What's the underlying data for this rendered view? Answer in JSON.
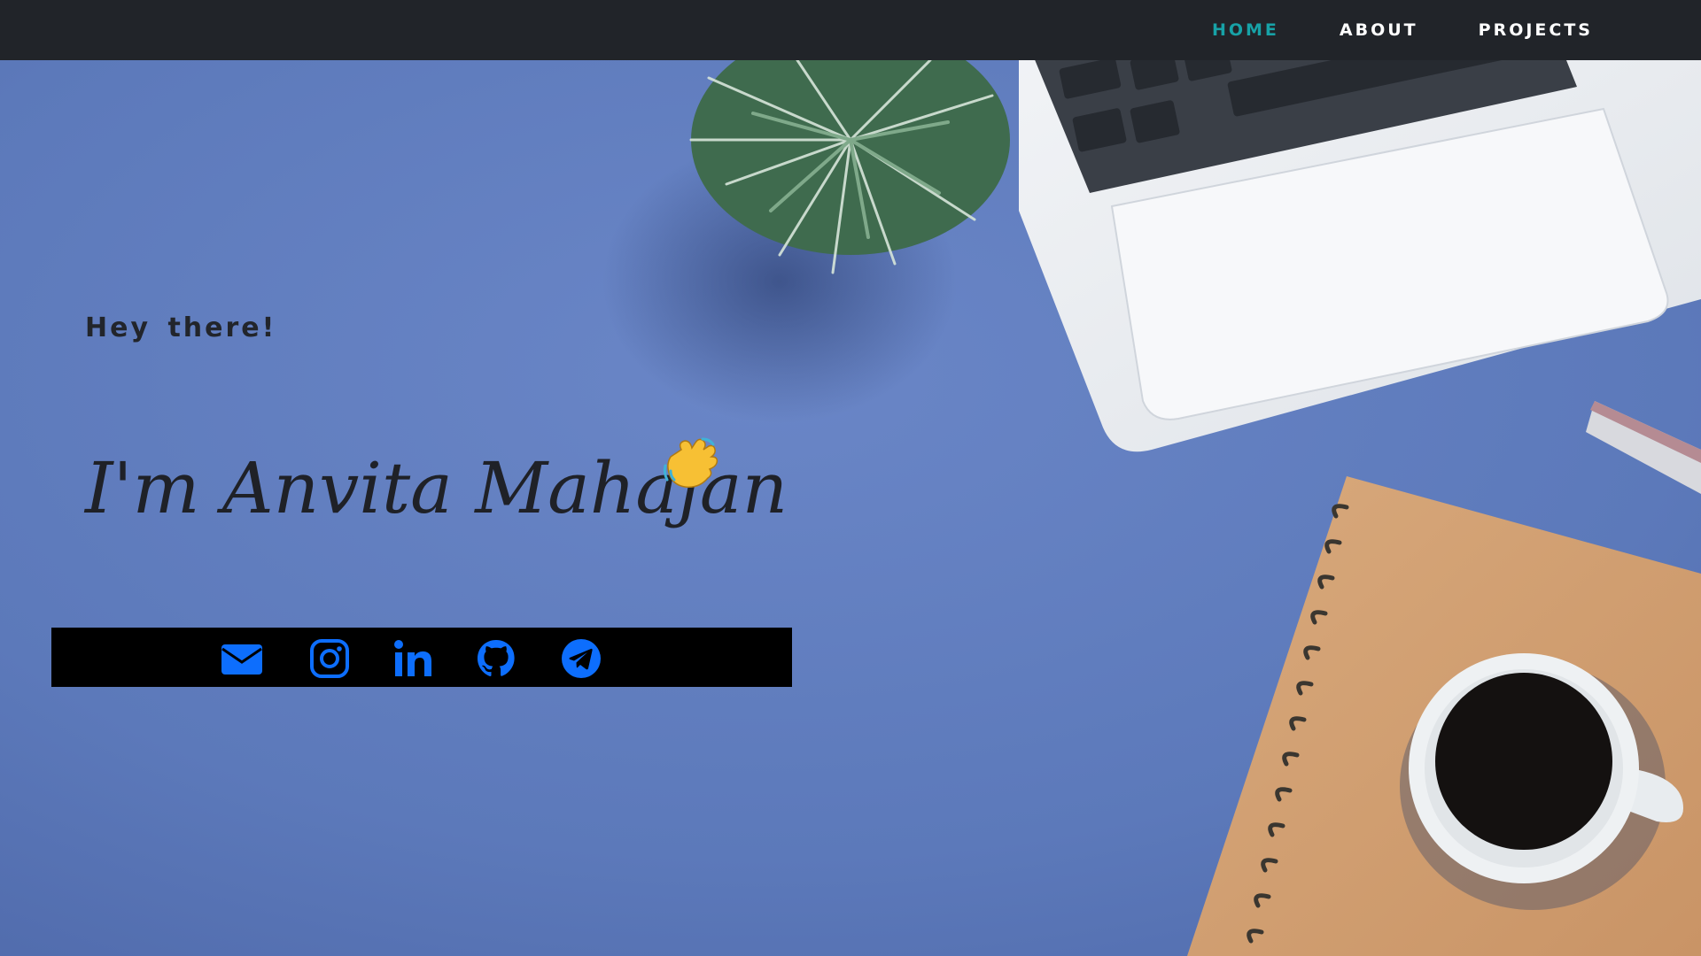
{
  "nav": {
    "items": [
      {
        "label": "HOME",
        "active": true
      },
      {
        "label": "ABOUT",
        "active": false
      },
      {
        "label": "PROJECTS",
        "active": false
      }
    ]
  },
  "hero": {
    "greeting": "Hey there!",
    "headline": "I'm Anvita Mahajan",
    "emoji": "waving-hand"
  },
  "social": {
    "icons": [
      "email-icon",
      "instagram-icon",
      "linkedin-icon",
      "github-icon",
      "telegram-icon"
    ]
  },
  "colors": {
    "navbar_bg": "#212429",
    "nav_active": "#17a2a7",
    "nav_text": "#ffffff",
    "background_blue": "#5a78b8",
    "social_bar_bg": "#000000",
    "social_icon": "#0d6efd",
    "text_dark": "#22252b"
  }
}
